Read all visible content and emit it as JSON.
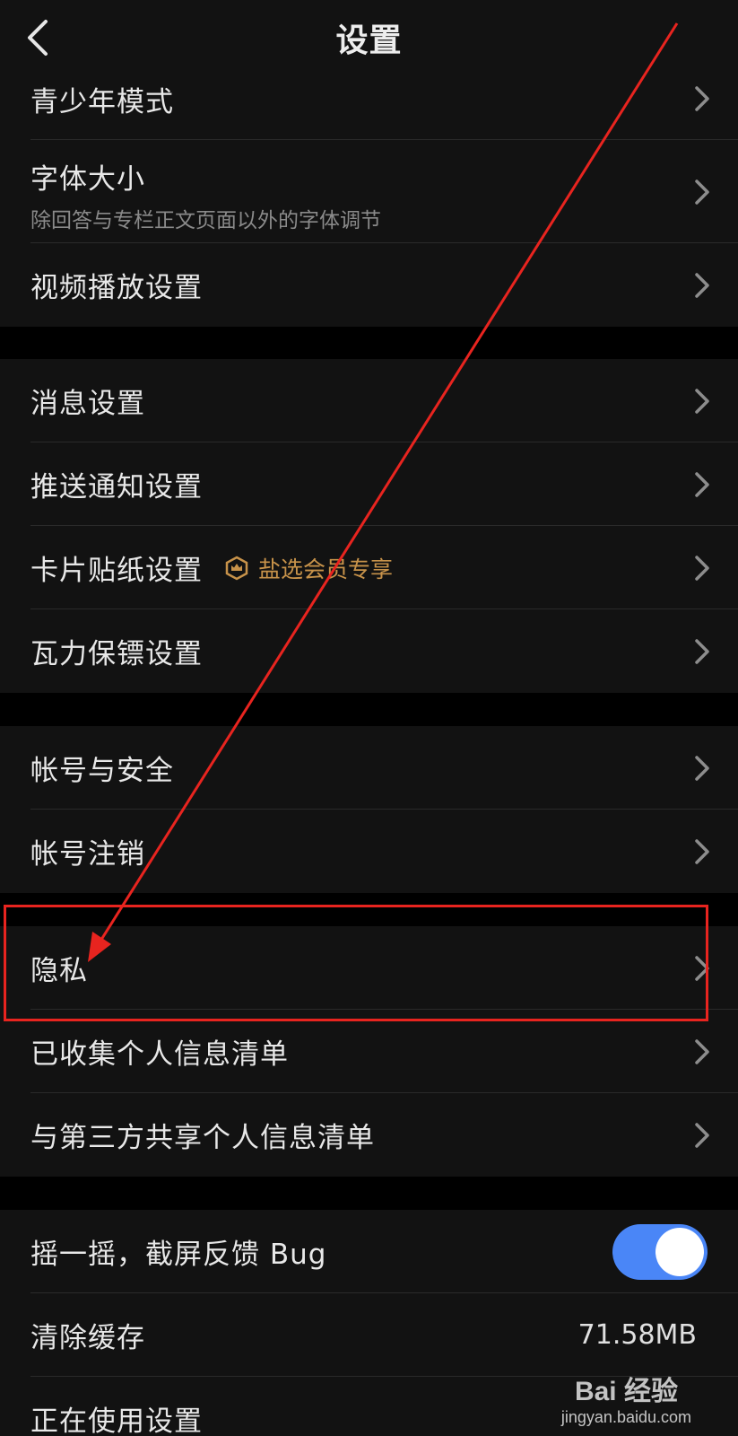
{
  "nav": {
    "title": "设置",
    "back_icon": "chevron-left-icon"
  },
  "group1": [
    {
      "label": "青少年模式"
    },
    {
      "label": "字体大小",
      "sub": "除回答与专栏正文页面以外的字体调节"
    },
    {
      "label": "视频播放设置"
    }
  ],
  "group2": [
    {
      "label": "消息设置"
    },
    {
      "label": "推送通知设置"
    },
    {
      "label": "卡片贴纸设置",
      "badge": "盐选会员专享",
      "badge_icon": "crown-shield-icon"
    },
    {
      "label": "瓦力保镖设置"
    }
  ],
  "group3": [
    {
      "label": "帐号与安全"
    },
    {
      "label": "帐号注销"
    }
  ],
  "group4": [
    {
      "label": "隐私"
    },
    {
      "label": "已收集个人信息清单"
    },
    {
      "label": "与第三方共享个人信息清单"
    }
  ],
  "group5": [
    {
      "label": "摇一摇，截屏反馈 Bug",
      "toggle_on": true
    },
    {
      "label": "清除缓存",
      "value": "71.58MB"
    },
    {
      "label": "正在使用设置"
    }
  ],
  "watermark": {
    "logo": "Bai 经验",
    "url": "jingyan.baidu.com"
  },
  "colors": {
    "background": "#000000",
    "cell": "#121212",
    "toggle_on": "#4a86f7",
    "badge": "#c8934a",
    "annotation": "#e8241f"
  }
}
